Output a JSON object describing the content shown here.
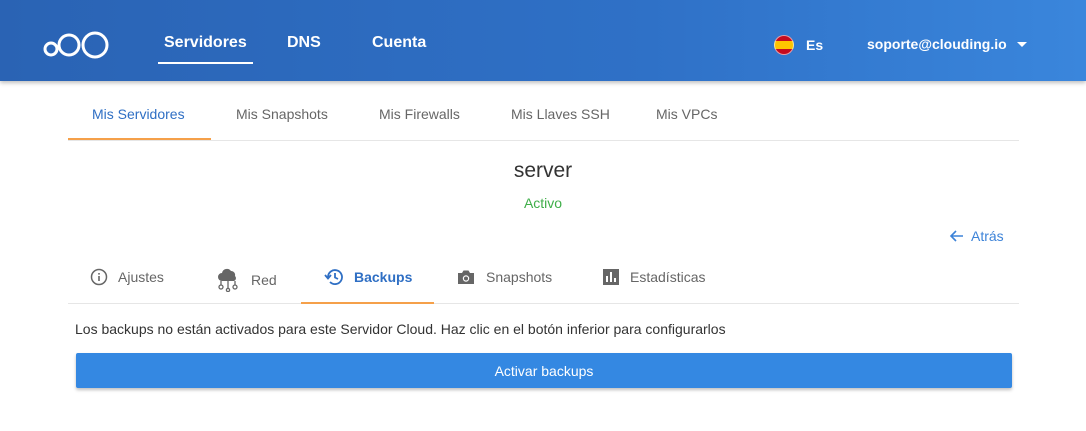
{
  "header": {
    "nav": [
      "Servidores",
      "DNS",
      "Cuenta"
    ],
    "language": "Es",
    "user_email": "soporte@clouding.io"
  },
  "subtabs": [
    "Mis Servidores",
    "Mis Snapshots",
    "Mis Firewalls",
    "Mis Llaves SSH",
    "Mis VPCs"
  ],
  "server": {
    "name": "server",
    "status": "Activo",
    "back_label": "Atrás"
  },
  "detail_tabs": [
    "Ajustes",
    "Red",
    "Backups",
    "Snapshots",
    "Estadísticas"
  ],
  "backups": {
    "message": "Los backups no están activados para este Servidor Cloud. Haz clic en el botón inferior para configurarlos",
    "button_label": "Activar backups"
  },
  "colors": {
    "header": "#2f71c7",
    "accent_tab": "#f5a04a",
    "status_ok": "#3fae49",
    "primary": "#3488e2"
  }
}
